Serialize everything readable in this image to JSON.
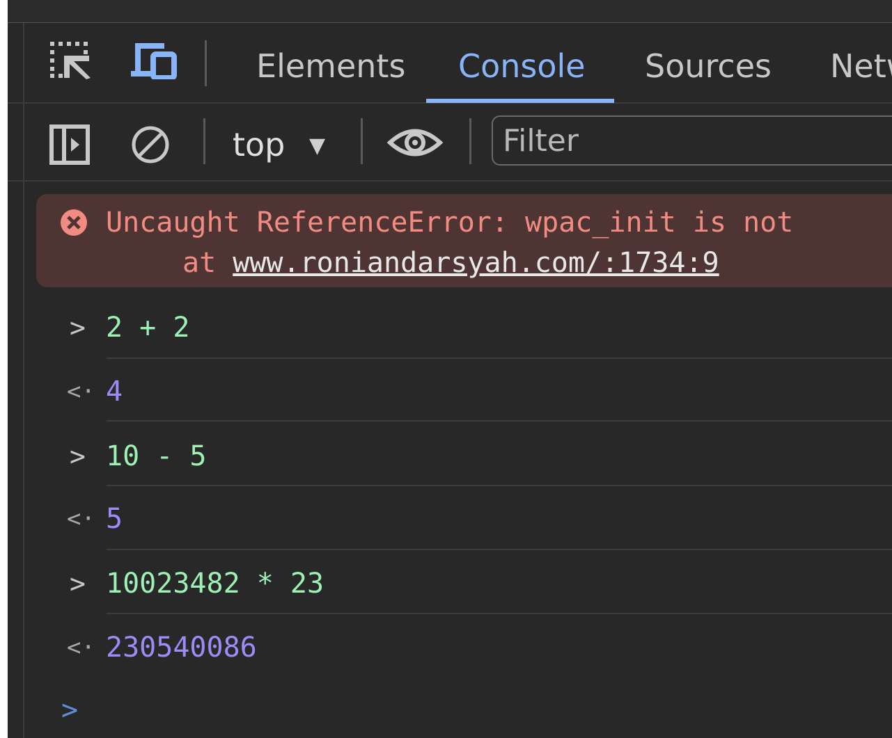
{
  "tabs": [
    {
      "label": "Elements",
      "active": false
    },
    {
      "label": "Console",
      "active": true
    },
    {
      "label": "Sources",
      "active": false
    },
    {
      "label": "Netw",
      "active": false
    }
  ],
  "toolbar": {
    "context": "top",
    "filter_placeholder": "Filter"
  },
  "console": {
    "error": {
      "message": "Uncaught ReferenceError: wpac_init is not",
      "at_prefix": "at ",
      "link": "www.roniandarsyah.com/:1734:9"
    },
    "entries": [
      {
        "type": "input",
        "text": "2 + 2"
      },
      {
        "type": "output",
        "text": "4"
      },
      {
        "type": "input",
        "text": "10 - 5"
      },
      {
        "type": "output",
        "text": "5"
      },
      {
        "type": "input",
        "text": "10023482 * 23"
      },
      {
        "type": "output",
        "text": "230540086"
      }
    ],
    "prompt_glyph": ">",
    "return_glyph": "<·"
  },
  "colors": {
    "accent": "#8ab4f8",
    "error_text": "#f28b82",
    "error_bg": "#4e3534",
    "input_text": "#9ef0b5",
    "output_text": "#9d8cf7"
  },
  "icons": {
    "inspect": "inspect-element-icon",
    "device": "device-toolbar-icon",
    "sidebar": "sidebar-toggle-icon",
    "clear": "clear-console-icon",
    "dropdown": "dropdown-arrow-icon",
    "eye": "live-expression-eye-icon",
    "error": "error-circle-icon"
  }
}
